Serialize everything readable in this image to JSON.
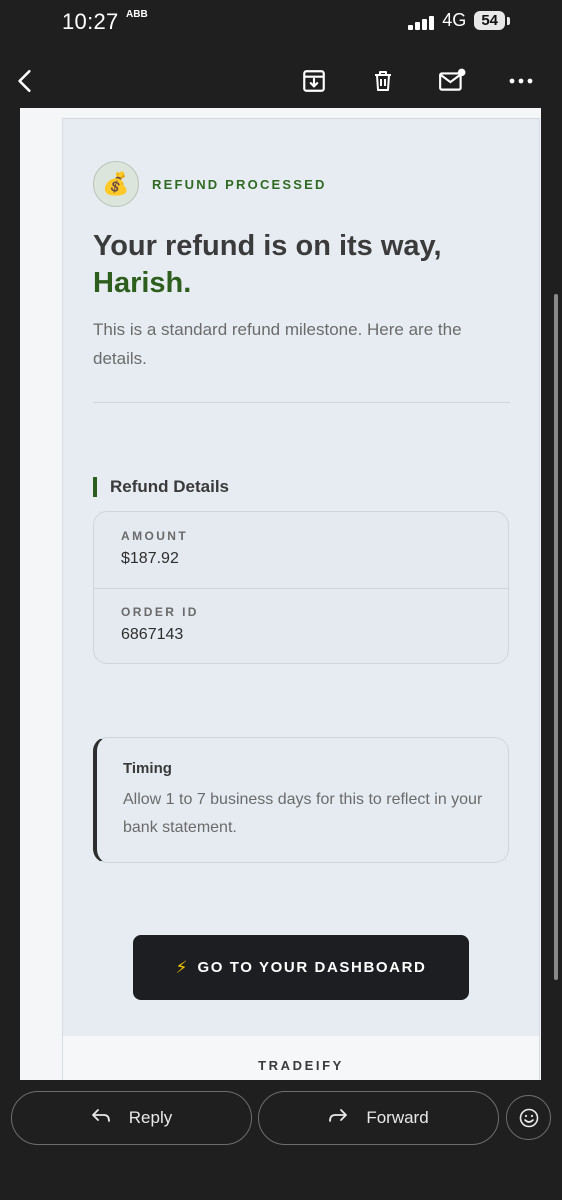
{
  "status_bar": {
    "time": "10:27",
    "notification_glyph": "ABB",
    "network": "4G",
    "battery": "54"
  },
  "toolbar": {
    "icons": [
      "back-arrow-icon",
      "archive-icon",
      "delete-icon",
      "mark-unread-icon",
      "more-options-icon"
    ]
  },
  "email": {
    "badge_icon": "money-bag-icon",
    "badge_emoji": "💰",
    "badge_label": "REFUND PROCESSED",
    "headline_prefix": "Your refund is on its way,",
    "headline_name": "Harish.",
    "lead": "This is a standard refund milestone. Here are the details.",
    "section_title": "Refund Details",
    "details": [
      {
        "label": "AMOUNT",
        "value": "$187.92"
      },
      {
        "label": "ORDER ID",
        "value": "6867143"
      }
    ],
    "timing": {
      "title": "Timing",
      "text": "Allow 1 to 7 business days for this to reflect in your bank statement."
    },
    "cta": {
      "icon": "⚡",
      "label": "GO TO YOUR DASHBOARD"
    },
    "footer_brand": "TRADEIFY"
  },
  "bottom_actions": {
    "reply": "Reply",
    "forward": "Forward",
    "emoji_icon": "emoji-reaction-icon"
  },
  "colors": {
    "accent_green": "#2d5e1e",
    "dark_button": "#1c1e22",
    "card_background": "#e7ecf2",
    "app_background": "#1f1f1f"
  }
}
